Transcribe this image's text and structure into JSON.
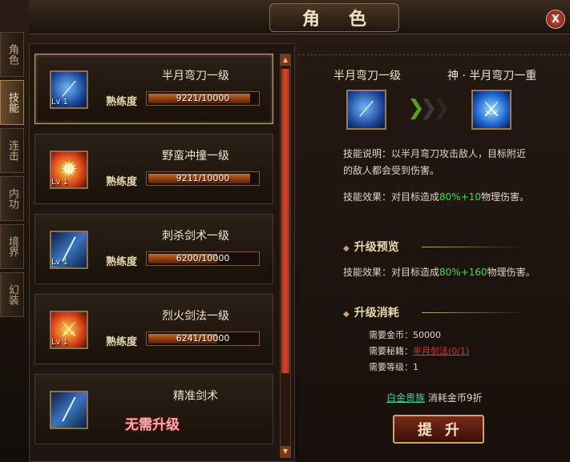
{
  "window": {
    "title": "角色",
    "close": "X"
  },
  "tabs": [
    {
      "label": "角色",
      "active": false
    },
    {
      "label": "技能",
      "active": true
    },
    {
      "label": "连击",
      "active": false
    },
    {
      "label": "内功",
      "active": false
    },
    {
      "label": "境界",
      "active": false
    },
    {
      "label": "幻装",
      "active": false
    }
  ],
  "skills": [
    {
      "name": "半月弯刀一级",
      "level": "Lv 1",
      "prof_label": "熟练度",
      "prof_text": "9221/10000",
      "prof_fraction": 0.9221,
      "icon": "crescent-blade-icon",
      "selected": true
    },
    {
      "name": "野蛮冲撞一级",
      "level": "Lv 1",
      "prof_label": "熟练度",
      "prof_text": "9211/10000",
      "prof_fraction": 0.9211,
      "icon": "fire-charge-icon",
      "selected": false
    },
    {
      "name": "刺杀剑术一级",
      "level": "Lv 1",
      "prof_label": "熟练度",
      "prof_text": "6200/10000",
      "prof_fraction": 0.62,
      "icon": "thrust-sword-icon",
      "selected": false
    },
    {
      "name": "烈火剑法一级",
      "level": "Lv 1",
      "prof_label": "熟练度",
      "prof_text": "6241/10000",
      "prof_fraction": 0.6241,
      "icon": "flame-sword-icon",
      "selected": false
    },
    {
      "name": "精准剑术",
      "no_upgrade": "无需升级",
      "icon": "precision-sword-icon"
    }
  ],
  "detail": {
    "current_name": "半月弯刀一级",
    "next_name": "神 · 半月弯刀一重",
    "desc_label": "技能说明：",
    "desc_text": "以半月弯刀攻击敌人，目标附近的敌人都会受到伤害。",
    "effect_label": "技能效果：",
    "effect_prefix": "对目标造成",
    "effect_value": "80%+10",
    "effect_suffix": "物理伤害。",
    "preview_title": "升级预览",
    "preview_label": "技能效果：",
    "preview_prefix": "对目标造成",
    "preview_value": "80%+160",
    "preview_suffix": "物理伤害。",
    "cost_title": "升级消耗",
    "gold_label": "需要金币：",
    "gold_value": "50000",
    "book_label": "需要秘籍：",
    "book_value": "半月剑法(0/1)",
    "lvl_label": "需要等级：",
    "lvl_value": "1",
    "vip_link": "白金贵族",
    "vip_text": "消耗金币9折",
    "upgrade_button": "提升"
  }
}
